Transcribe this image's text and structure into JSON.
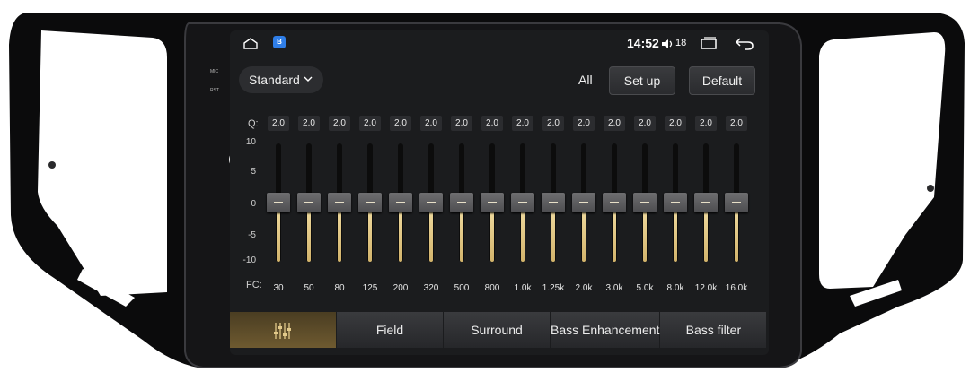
{
  "status_bar": {
    "time": "14:52",
    "volume_level": "18",
    "icons": [
      "home-icon",
      "app-badge-icon",
      "volume-icon",
      "recents-icon",
      "back-icon"
    ]
  },
  "device_labels": {
    "mic": "MIC",
    "rst": "RST"
  },
  "controls": {
    "preset": "Standard",
    "all_label": "All",
    "setup_label": "Set up",
    "default_label": "Default"
  },
  "eq": {
    "q_label": "Q:",
    "fc_label": "FC:",
    "scale": [
      "10",
      "5",
      "0",
      "-5",
      "-10"
    ],
    "range": [
      -10,
      10
    ],
    "bands": [
      {
        "fc": "30",
        "q": "2.0",
        "gain": 0
      },
      {
        "fc": "50",
        "q": "2.0",
        "gain": 0
      },
      {
        "fc": "80",
        "q": "2.0",
        "gain": 0
      },
      {
        "fc": "125",
        "q": "2.0",
        "gain": 0
      },
      {
        "fc": "200",
        "q": "2.0",
        "gain": 0
      },
      {
        "fc": "320",
        "q": "2.0",
        "gain": 0
      },
      {
        "fc": "500",
        "q": "2.0",
        "gain": 0
      },
      {
        "fc": "800",
        "q": "2.0",
        "gain": 0
      },
      {
        "fc": "1.0k",
        "q": "2.0",
        "gain": 0
      },
      {
        "fc": "1.25k",
        "q": "2.0",
        "gain": 0
      },
      {
        "fc": "2.0k",
        "q": "2.0",
        "gain": 0
      },
      {
        "fc": "3.0k",
        "q": "2.0",
        "gain": 0
      },
      {
        "fc": "5.0k",
        "q": "2.0",
        "gain": 0
      },
      {
        "fc": "8.0k",
        "q": "2.0",
        "gain": 0
      },
      {
        "fc": "12.0k",
        "q": "2.0",
        "gain": 0
      },
      {
        "fc": "16.0k",
        "q": "2.0",
        "gain": 0
      }
    ]
  },
  "tabs": [
    {
      "label": "",
      "icon": "equalizer-icon",
      "active": true
    },
    {
      "label": "Field",
      "active": false
    },
    {
      "label": "Surround",
      "active": false
    },
    {
      "label": "Bass Enhancement",
      "active": false
    },
    {
      "label": "Bass filter",
      "active": false
    }
  ]
}
